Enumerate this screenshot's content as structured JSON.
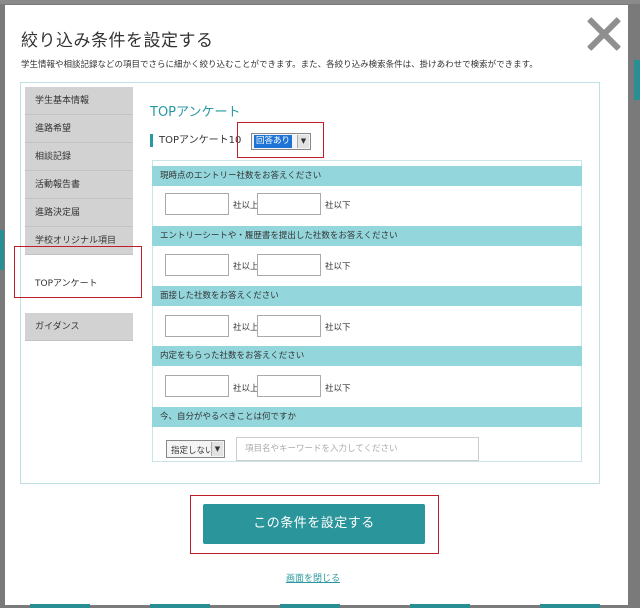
{
  "modal": {
    "title": "絞り込み条件を設定する",
    "subtitle": "学生情報や相談記録などの項目でさらに細かく絞り込むことができます。また、各絞り込み検索条件は、掛けあわせで検索ができます。"
  },
  "sidebar": {
    "items": [
      {
        "label": "学生基本情報"
      },
      {
        "label": "進路希望"
      },
      {
        "label": "相談記録"
      },
      {
        "label": "活動報告書"
      },
      {
        "label": "進路決定届"
      },
      {
        "label": "学校オリジナル項目"
      },
      {
        "label": "TOPアンケート",
        "active": true
      },
      {
        "label": "ガイダンス"
      }
    ]
  },
  "content": {
    "section_title": "TOPアンケート",
    "filter_label": "TOPアンケート10",
    "filter_value": "回答あり",
    "questions": [
      {
        "label": "現時点のエントリー社数をお答えください",
        "min_unit": "社以上",
        "max_unit": "社以下"
      },
      {
        "label": "エントリーシートや・履歴書を提出した社数をお答えください",
        "min_unit": "社以上",
        "max_unit": "社以下"
      },
      {
        "label": "面接した社数をお答えください",
        "min_unit": "社以上",
        "max_unit": "社以下"
      },
      {
        "label": "内定をもらった社数をお答えください",
        "min_unit": "社以上",
        "max_unit": "社以下"
      },
      {
        "label": "今、自分がやるべきことは何ですか",
        "select_value": "指定しない",
        "placeholder": "項目名やキーワードを入力してください"
      }
    ]
  },
  "footer": {
    "submit_label": "この条件を設定する",
    "close_label": "画面を閉じる"
  },
  "colors": {
    "accent": "#2a959b",
    "band": "#93d6dc",
    "highlight": "#c21c28"
  }
}
